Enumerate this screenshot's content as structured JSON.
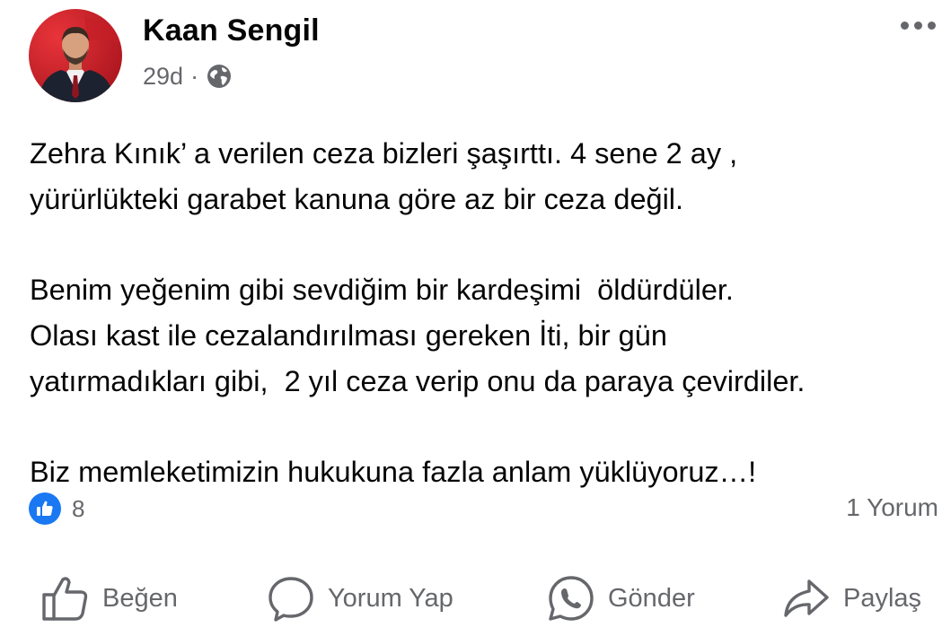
{
  "post": {
    "author": "Kaan Sengil",
    "time": "29d",
    "separator": "·",
    "audience_icon": "globe-icon",
    "more_icon": "more-options-icon",
    "paragraphs": [
      [
        "Zehra Kınık’ a verilen ceza bizleri şaşırttı. 4 sene 2 ay ,",
        "yürürlükteki garabet kanuna göre az bir ceza değil."
      ],
      [
        "Benim yeğenim gibi sevdiğim bir kardeşimi  öldürdüler.",
        "Olası kast ile cezalandırılması gereken İti, bir gün",
        "yatırmadıkları gibi,  2 yıl ceza verip onu da paraya çevirdiler."
      ],
      [
        "Biz memleketimizin hukukuna fazla anlam yüklüyoruz…!"
      ]
    ]
  },
  "reactions": {
    "icon": "like-reaction-icon",
    "count": "8",
    "comments": "1 Yorum"
  },
  "actions": {
    "like": "Beğen",
    "comment": "Yorum Yap",
    "send": "Gönder",
    "share": "Paylaş"
  },
  "colors": {
    "text": "#050505",
    "secondary": "#65676b",
    "like_blue": "#1a78f2"
  }
}
